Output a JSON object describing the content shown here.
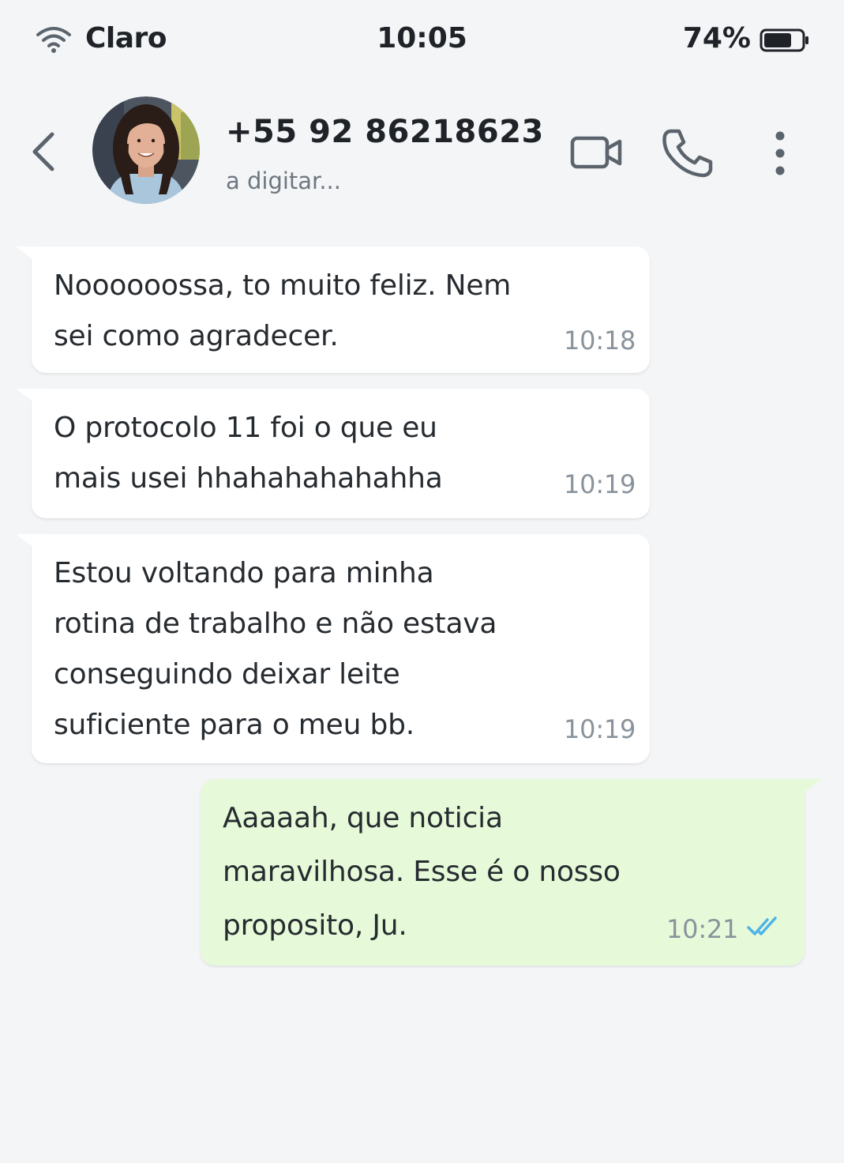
{
  "status_bar": {
    "carrier": "Claro",
    "time": "10:05",
    "battery": "74%",
    "battery_level": 0.74
  },
  "header": {
    "contact_name": "+55 92 86218623",
    "contact_status": "a digitar..."
  },
  "messages": [
    {
      "direction": "incoming",
      "text": "Noooooossa, to muito feliz. Nem\nsei como agradecer.",
      "time": "10:18"
    },
    {
      "direction": "incoming",
      "text": "O protocolo 11 foi o que eu\nmais usei hhahahahahahha",
      "time": "10:19"
    },
    {
      "direction": "incoming",
      "text": "Estou voltando para minha\nrotina de trabalho e não estava\nconseguindo deixar leite\nsuficiente para o meu bb.",
      "time": "10:19"
    },
    {
      "direction": "outgoing",
      "text": "Aaaaah, que noticia\nmaravilhosa. Esse é o nosso\nproposito, Ju.",
      "time": "10:21",
      "read": true
    }
  ],
  "colors": {
    "background": "#f4f5f7",
    "incoming_bubble": "#ffffff",
    "outgoing_bubble": "#e6fad9",
    "read_ticks": "#4fb3e8",
    "icon": "#5b646c"
  },
  "icons": {
    "wifi": "wifi-icon",
    "battery": "battery-icon",
    "back": "chevron-left-icon",
    "video": "video-camera-icon",
    "call": "phone-icon",
    "more": "more-vertical-icon",
    "read": "double-check-icon"
  }
}
